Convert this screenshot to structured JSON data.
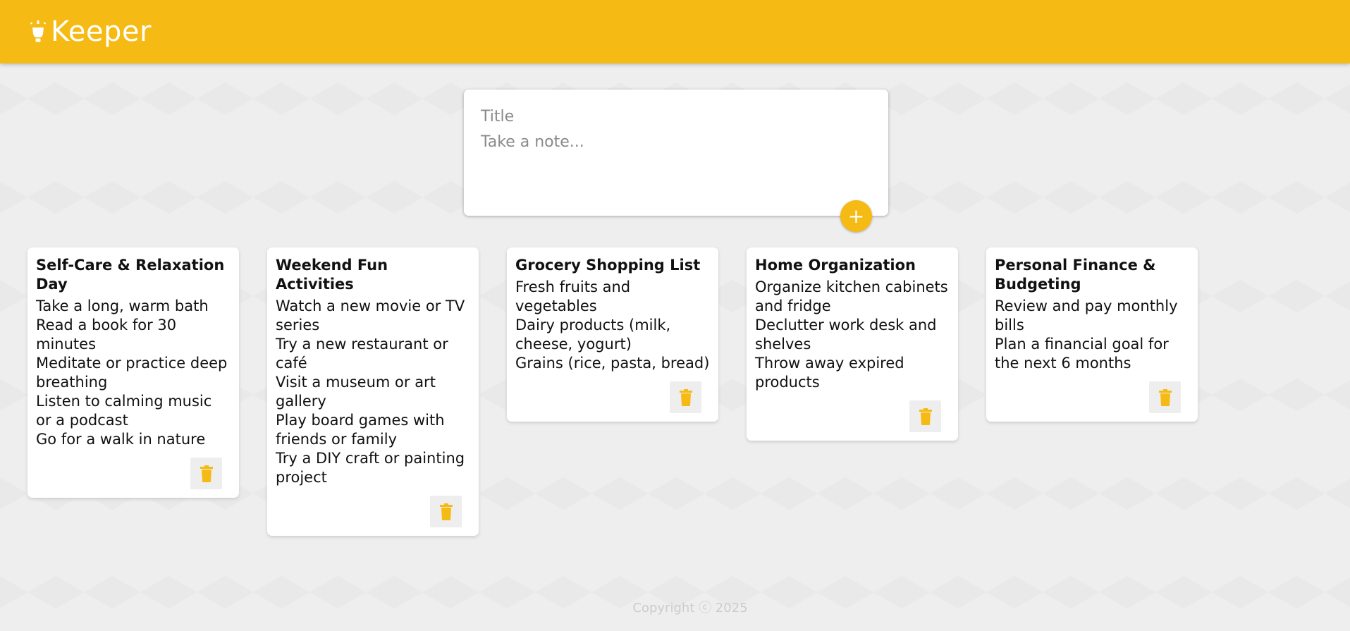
{
  "app": {
    "name": "Keeper",
    "brand_color": "#f5ba13",
    "logo_icon": "lightbulb-icon"
  },
  "create_note": {
    "title_placeholder": "Title",
    "content_placeholder": "Take a note...",
    "title_value": "",
    "content_value": "",
    "add_button_label": "+",
    "add_button_icon": "plus-icon"
  },
  "notes": [
    {
      "title": "Self-Care & Relaxation Day",
      "lines": [
        "Take a long, warm bath",
        "Read a book for 30 minutes",
        "Meditate or practice deep breathing",
        "Listen to calming music or a podcast",
        "Go for a walk in nature"
      ],
      "delete_icon": "trash-icon"
    },
    {
      "title": "Weekend Fun Activities",
      "lines": [
        "Watch a new movie or TV series",
        "Try a new restaurant or café",
        "Visit a museum or art gallery",
        "Play board games with friends or family",
        "Try a DIY craft or painting project"
      ],
      "delete_icon": "trash-icon"
    },
    {
      "title": "Grocery Shopping List",
      "lines": [
        "Fresh fruits and vegetables",
        "Dairy products (milk, cheese, yogurt)",
        "Grains (rice, pasta, bread)"
      ],
      "delete_icon": "trash-icon"
    },
    {
      "title": "Home Organization",
      "lines": [
        "Organize kitchen cabinets and fridge",
        "Declutter work desk and shelves",
        "Throw away expired products"
      ],
      "delete_icon": "trash-icon"
    },
    {
      "title": "Personal Finance & Budgeting",
      "lines": [
        "Review and pay monthly bills",
        "Plan a financial goal for the next 6 months"
      ],
      "delete_icon": "trash-icon"
    }
  ],
  "footer": {
    "text": "Copyright ⓒ 2025"
  }
}
